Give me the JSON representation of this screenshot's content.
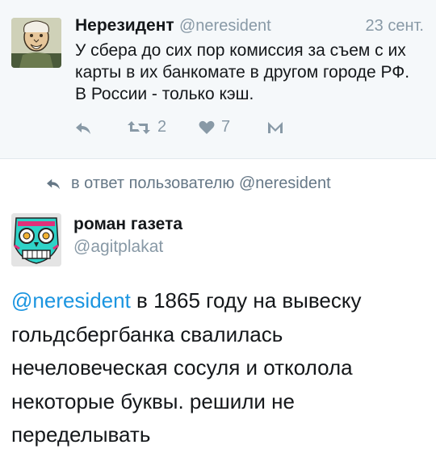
{
  "parent": {
    "name": "Нерезидент",
    "handle": "@neresident",
    "date": "23 сент.",
    "text": "У сбера до сих пор комиссия за съем с их карты в их банкомате в другом городе РФ. В России - только кэш.",
    "retweets": "2",
    "likes": "7",
    "icons": [
      "reply-icon",
      "retweet-icon",
      "heart-icon",
      "direct-message-icon"
    ]
  },
  "reply_context": {
    "text": "в ответ пользователю @neresident"
  },
  "tweet": {
    "name": "роман газета",
    "handle": "@agitplakat",
    "mention": "@neresident",
    "text": " в 1865 году на вывеску гольдсбергбанка свалилась нечеловеческая сосуля и отколола некоторые буквы. решили не переделывать"
  },
  "colors": {
    "link": "#1b95e0",
    "secondary": "#8899a6",
    "parent_bg": "#f5f8fa"
  }
}
